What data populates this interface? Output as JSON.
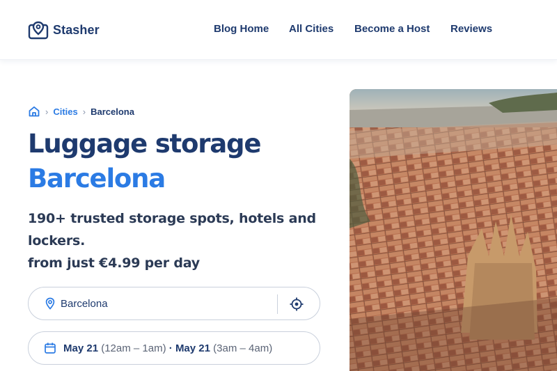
{
  "brand": {
    "name": "Stasher",
    "icon": "map-pin-luggage-icon"
  },
  "nav": {
    "items": [
      {
        "label": "Blog Home"
      },
      {
        "label": "All Cities"
      },
      {
        "label": "Become a Host"
      },
      {
        "label": "Reviews"
      }
    ]
  },
  "breadcrumb": {
    "home_icon": "home-icon",
    "items": [
      {
        "label": "Cities"
      },
      {
        "label": "Barcelona"
      }
    ]
  },
  "hero": {
    "title_line1": "Luggage storage",
    "title_line2": "Barcelona",
    "subtitle_line1": "190+ trusted storage spots, hotels and",
    "subtitle_line2": "lockers.",
    "subtitle_line3": "from just €4.99 per day"
  },
  "search": {
    "location_value": "Barcelona",
    "location_icon": "map-pin-icon",
    "locate_icon": "crosshair-icon",
    "date_icon": "calendar-icon",
    "dropoff_date": "May 21",
    "dropoff_time": "(12am – 1am)",
    "separator": "·",
    "pickup_date": "May 21",
    "pickup_time": "(3am – 4am)"
  },
  "colors": {
    "navy": "#1e3a6e",
    "accent_blue": "#2b7be4",
    "border": "#c9d0dc",
    "text_dark": "#2b3a55"
  },
  "image": {
    "subject": "aerial-city-photo-icon"
  }
}
